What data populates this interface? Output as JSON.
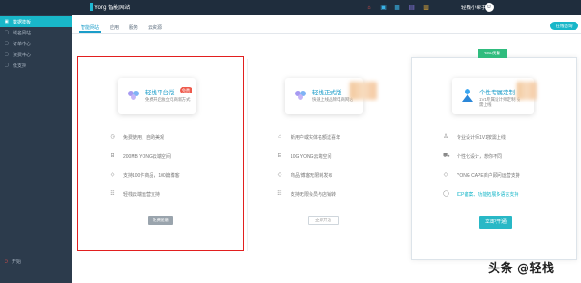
{
  "app": {
    "brand": "Yong 智能网站",
    "user_name": "轻栈小帮手",
    "avatar_text": "☺"
  },
  "header_icons": [
    {
      "name": "home-icon",
      "glyph": "⌂",
      "color": "#e0504c"
    },
    {
      "name": "monitor-icon",
      "glyph": "▣",
      "color": "#3ab3e6"
    },
    {
      "name": "grid-icon",
      "glyph": "▦",
      "color": "#3ab3e6"
    },
    {
      "name": "folder-icon",
      "glyph": "▤",
      "color": "#8c7ae6"
    },
    {
      "name": "bag-icon",
      "glyph": "▥",
      "color": "#f5b537"
    }
  ],
  "sidebar": {
    "items": [
      {
        "label": "数据模板",
        "icon": "▣",
        "active": true
      },
      {
        "label": "域名网站",
        "icon": "▢",
        "active": false
      },
      {
        "label": "订单中心",
        "icon": "▢",
        "active": false
      },
      {
        "label": "资费中心",
        "icon": "▢",
        "active": false
      },
      {
        "label": "低支持",
        "icon": "▢",
        "active": false
      }
    ],
    "bottom_label": "开始"
  },
  "tabs": [
    {
      "label": "智能网站",
      "active": true
    },
    {
      "label": "应用",
      "active": false
    },
    {
      "label": "服务",
      "active": false
    },
    {
      "label": "云资源",
      "active": false
    }
  ],
  "top_right_button": "在线咨询",
  "plans": [
    {
      "title": "轻栈平台版",
      "subtitle": "免费开启独立电商新方式",
      "badge": "免费",
      "features": [
        {
          "icon": "◷",
          "text": "免费使用，自助美观"
        },
        {
          "icon": "⊟",
          "text": "200MB YONG云端空间"
        },
        {
          "icon": "◇",
          "text": "支持100件商品，100篇博客"
        },
        {
          "icon": "☷",
          "text": "轻栈云端运营支持"
        }
      ],
      "button": "免费随意"
    },
    {
      "title": "轻栈正式版",
      "subtitle": "快速上线品牌电商网站",
      "features": [
        {
          "icon": "⌂",
          "text": "新用户或实体名额送喜年"
        },
        {
          "icon": "⊟",
          "text": "10G YONG云端空间"
        },
        {
          "icon": "◇",
          "text": "商品/博客无限制发布"
        },
        {
          "icon": "☷",
          "text": "支持无限会员与店铺转"
        }
      ],
      "button": "立即开通"
    },
    {
      "title": "个性专属定制",
      "subtitle": "1V1专属设计师定制 按需上线",
      "recommend": "20%优惠",
      "features": [
        {
          "icon": "♙",
          "text": "专业设计师1V1按需上线"
        },
        {
          "icon": "⛟",
          "text": "个性化设计，想你不同"
        },
        {
          "icon": "◇",
          "text": "YONG CAPE商户顾问运营支持"
        },
        {
          "icon": "◯",
          "text": "ICP备案、功能拓展多语言支持",
          "link": true
        }
      ],
      "button": "立即开通"
    }
  ],
  "watermark": "头条 @轻栈"
}
